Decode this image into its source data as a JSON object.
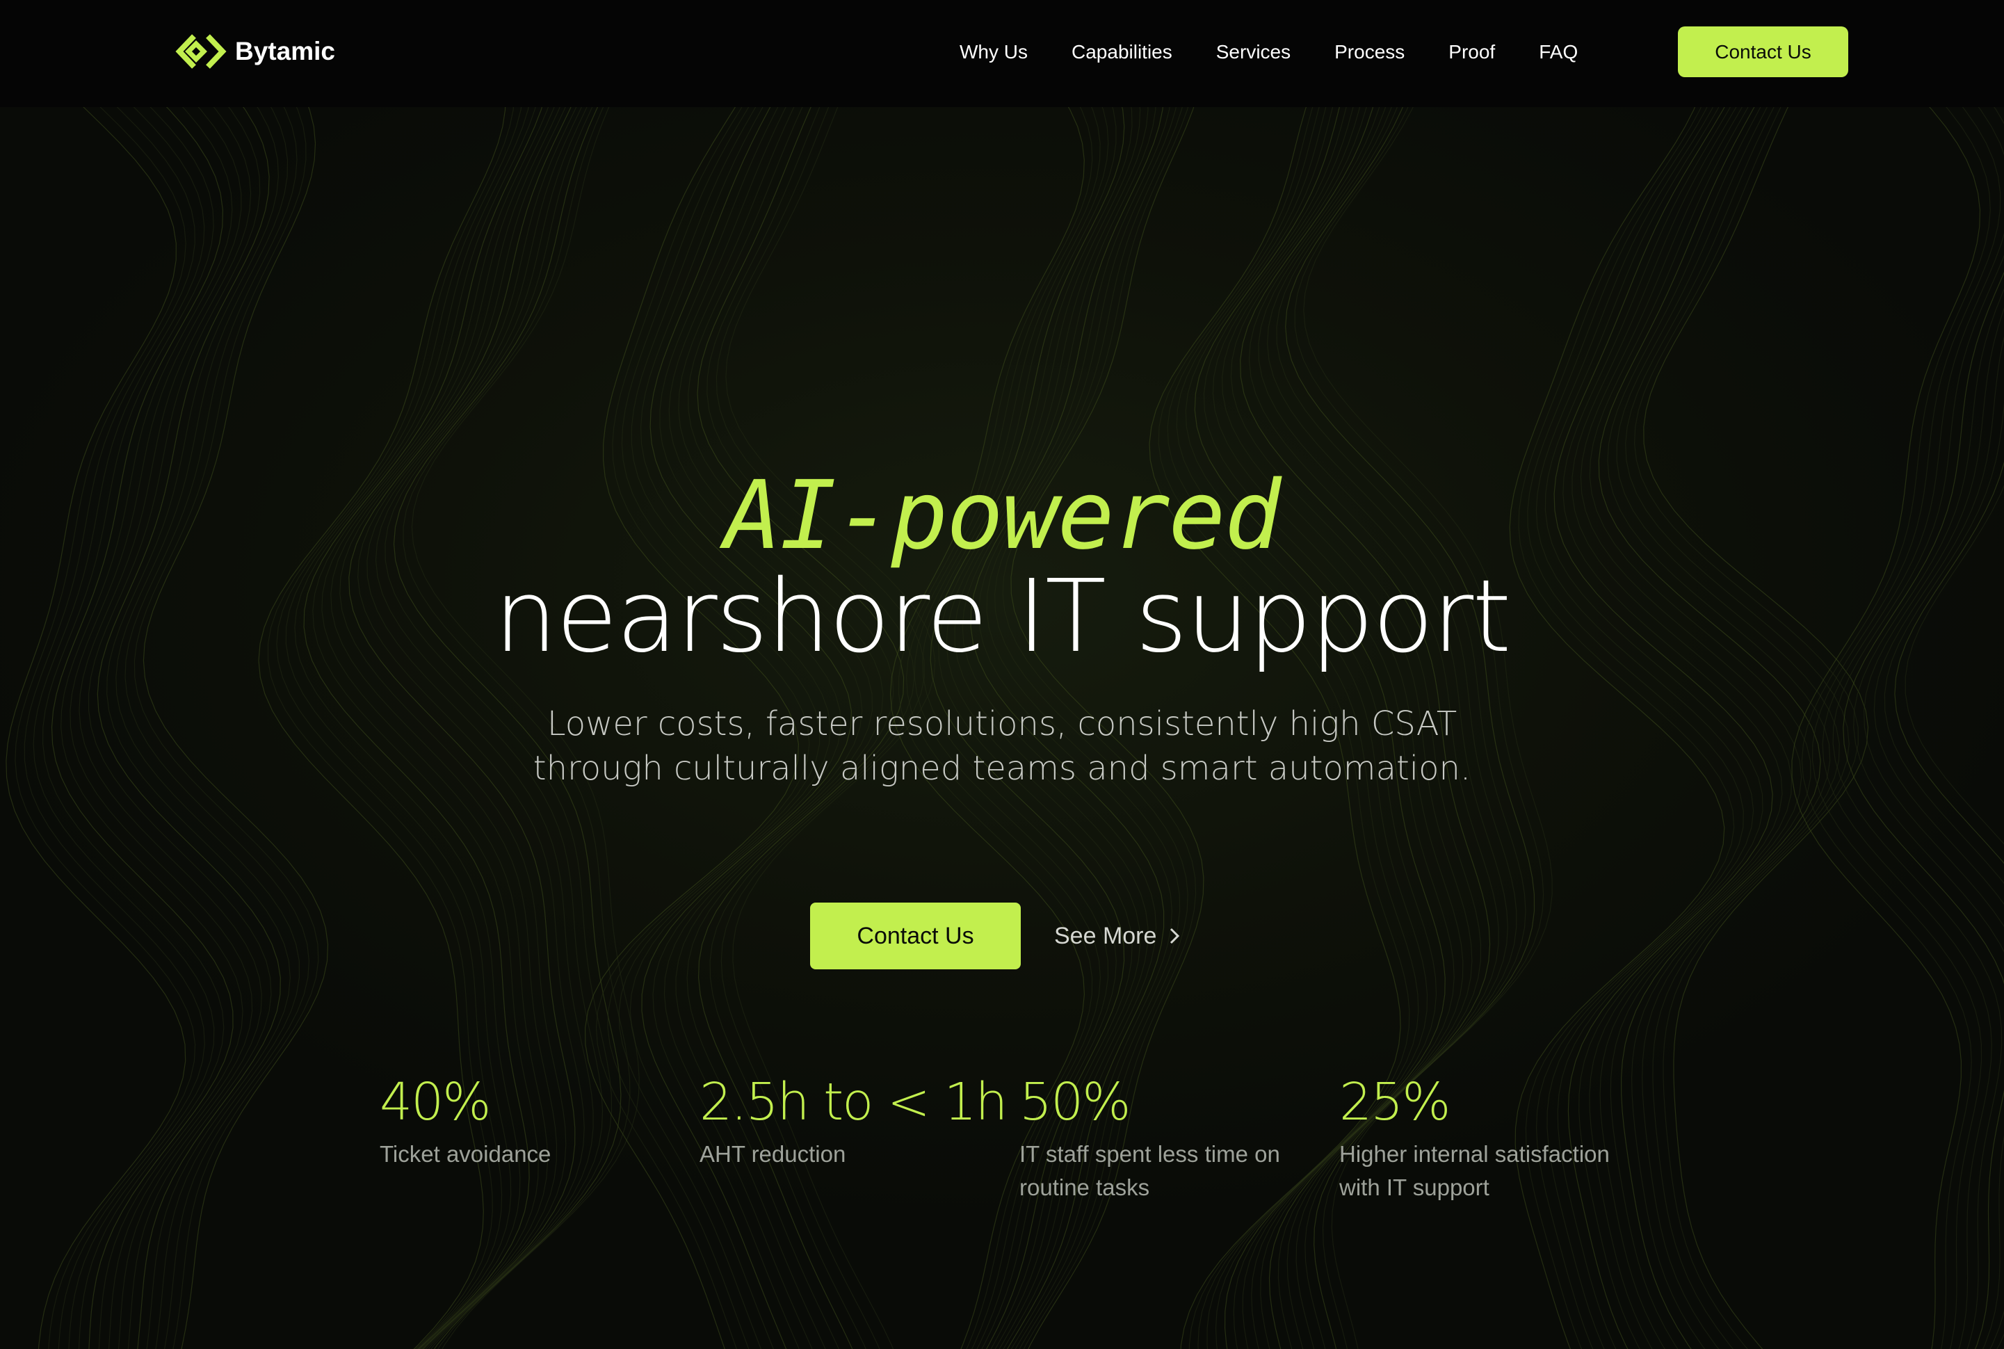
{
  "brand": {
    "name": "Bytamic",
    "logo_icon": "diamond-chevron-icon",
    "accent_color": "#c2ef4e",
    "background_color": "#0a0c08"
  },
  "nav": {
    "links": [
      "Why Us",
      "Capabilities",
      "Services",
      "Process",
      "Proof",
      "FAQ"
    ],
    "cta_label": "Contact Us"
  },
  "hero": {
    "kicker": "AI-powered",
    "title": "nearshore IT support",
    "subtitle": "Lower costs, faster resolutions, consistently high CSAT through culturally aligned teams and smart automation.",
    "primary_cta": "Contact Us",
    "secondary_cta": "See More",
    "secondary_icon": "chevron-right-icon"
  },
  "stats": [
    {
      "value": "40%",
      "label": "Ticket avoidance"
    },
    {
      "value": "2.5h to < 1h",
      "label": "AHT reduction"
    },
    {
      "value": "50%",
      "label": "IT staff spent less time on routine tasks"
    },
    {
      "value": "25%",
      "label": "Higher internal satisfaction with IT support"
    }
  ]
}
